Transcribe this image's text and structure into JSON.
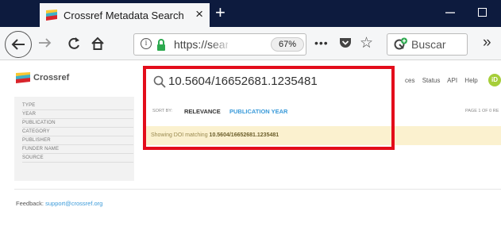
{
  "browser": {
    "tab_title": "Crossref Metadata Search",
    "tab_close": "×",
    "new_tab": "+",
    "url": "https://search",
    "zoom": "67%",
    "more": "•••",
    "search_placeholder": "Buscar",
    "overflow": "»"
  },
  "page": {
    "logo_text": "Crossref",
    "query": "10.5604/16652681.1235481",
    "top_links": [
      "ces",
      "Status",
      "API",
      "Help"
    ],
    "orcid_badge": "iD",
    "facets": [
      "TYPE",
      "YEAR",
      "PUBLICATION",
      "CATEGORY",
      "PUBLISHER",
      "FUNDER NAME",
      "SOURCE"
    ],
    "sort_by_label": "SORT BY:",
    "sort_relevance": "RELEVANCE",
    "sort_publication_year": "PUBLICATION YEAR",
    "page_info": "PAGE 1 OF 0 RE",
    "info_prefix": "Showing DOI matching",
    "info_doi": "10.5604/16652681.1235481",
    "feedback_label": "Feedback:",
    "feedback_email": "support@crossref.org"
  },
  "colors": {
    "highlight_box": "#e30d1b",
    "accent_blue": "#3a9ad9",
    "titlebar": "#0d1b3e"
  }
}
